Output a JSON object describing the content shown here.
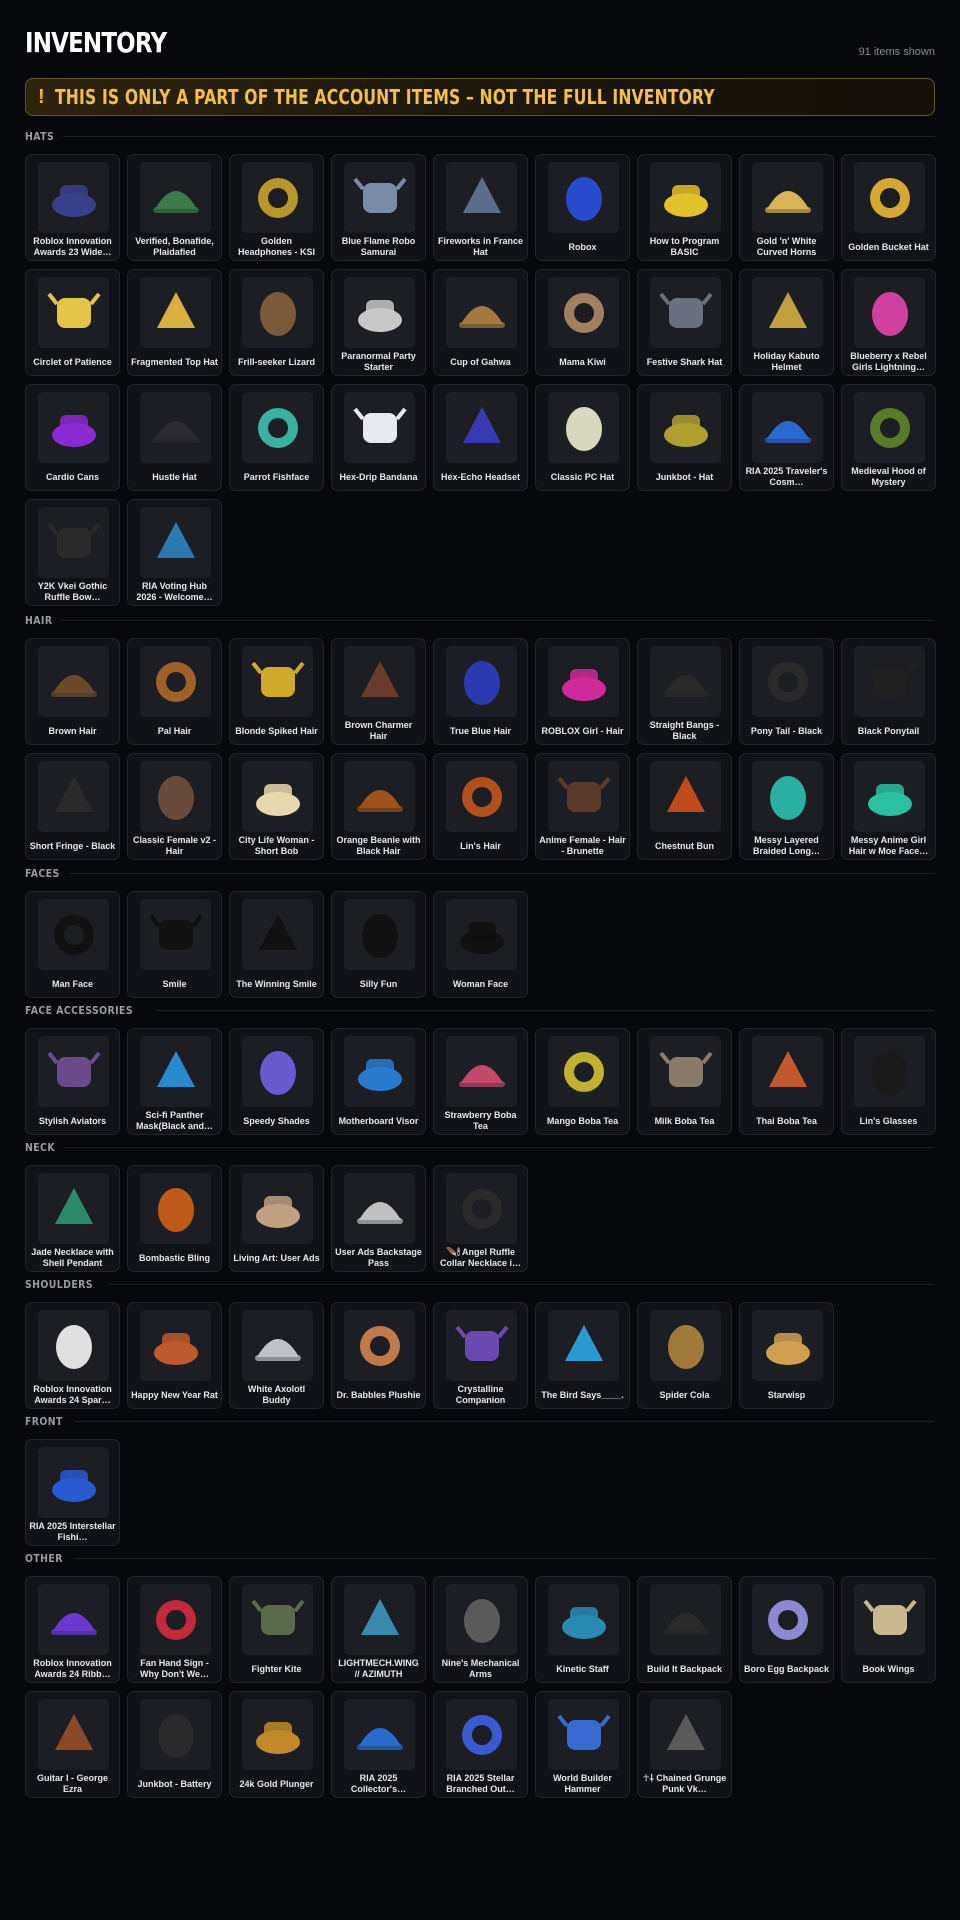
{
  "header": {
    "title": "INVENTORY",
    "count": "91 items shown"
  },
  "warning": {
    "icon": "!",
    "text": "THIS IS ONLY A PART OF THE ACCOUNT ITEMS – NOT THE FULL INVENTORY"
  },
  "colors": {
    "background": "#07080c",
    "card": "#111217",
    "warning_text": "#f3c049",
    "warning_border": "#6a5420"
  },
  "sections": [
    {
      "label": "HATS",
      "items": [
        {
          "name": "Roblox Innovation Awards 23 Wide…",
          "icon": "crown-hat-icon",
          "color": "#3a3f8a"
        },
        {
          "name": "Verified, Bonafide, Plaidafied",
          "icon": "plaid-cap-icon",
          "color": "#3c7a4a"
        },
        {
          "name": "Golden Headphones - KSI",
          "icon": "headphones-icon",
          "color": "#b8962e"
        },
        {
          "name": "Blue Flame Robo Samurai",
          "icon": "samurai-helmet-icon",
          "color": "#7a8aa8"
        },
        {
          "name": "Fireworks in France Hat",
          "icon": "eiffel-tower-icon",
          "color": "#5a6e8a"
        },
        {
          "name": "Robox",
          "icon": "box-icon",
          "color": "#1a2a6a"
        },
        {
          "name": "How to Program BASIC",
          "icon": "book-hat-icon",
          "color": "#e0c22a"
        },
        {
          "name": "Gold 'n' White Curved Horns",
          "icon": "horns-icon",
          "color": "#d8b35a"
        },
        {
          "name": "Golden Bucket Hat",
          "icon": "bucket-hat-icon",
          "color": "#d4a832"
        }
      ]
    },
    {
      "label": "",
      "items": [
        {
          "name": "Circlet of Patience",
          "icon": "circlet-icon",
          "color": "#e2c64a"
        },
        {
          "name": "Fragmented Top Hat",
          "icon": "top-hat-icon",
          "color": "#d8b040"
        },
        {
          "name": "Frill-seeker Lizard",
          "icon": "lizard-icon",
          "color": "#7a5a3a"
        },
        {
          "name": "Paranormal Party Starter",
          "icon": "ghost-icon",
          "color": "#c8c8c8"
        },
        {
          "name": "Cup of Gahwa",
          "icon": "cup-icon",
          "color": "#a07a40"
        },
        {
          "name": "Mama Kiwi",
          "icon": "kiwi-bird-icon",
          "color": "#a08060"
        },
        {
          "name": "Festive Shark Hat",
          "icon": "shark-hat-icon",
          "color": "#6a7080"
        },
        {
          "name": "Holiday Kabuto Helmet",
          "icon": "kabuto-icon",
          "color": "#c0a040"
        },
        {
          "name": "Blueberry x Rebel Girls Lightning…",
          "icon": "lightning-icon",
          "color": "#d040a0"
        }
      ]
    }
  ],
  "all_sections": [
    {
      "label": "HATS",
      "rows": [
        [
          "Roblox Innovation Awards 23 Wide…",
          "Verified, Bonafide, Plaidafied",
          "Golden Headphones - KSI",
          "Blue Flame Robo Samurai",
          "Fireworks in France Hat",
          "Robox",
          "How to Program BASIC",
          "Gold 'n' White Curved Horns",
          "Golden Bucket Hat"
        ],
        [
          "Circlet of Patience",
          "Fragmented Top Hat",
          "Frill-seeker Lizard",
          "Paranormal Party Starter",
          "Cup of Gahwa",
          "Mama Kiwi",
          "Festive Shark Hat",
          "Holiday Kabuto Helmet",
          "Blueberry x Rebel Girls Lightning…"
        ],
        [
          "Cardio Cans",
          "Hustle Hat",
          "Parrot Fishface",
          "Hex-Drip Bandana",
          "Hex-Echo Headset",
          "Classic PC Hat",
          "Junkbot - Hat",
          "RIA 2025 Traveler's Cosm…",
          "Medieval Hood of Mystery"
        ],
        [
          "Y2K Vkei Gothic Ruffle Bow…",
          "RIA Voting Hub 2026 - Welcome…"
        ]
      ],
      "colors": [
        [
          "#3a3f8a",
          "#3c7a4a",
          "#b8962e",
          "#7a8aa8",
          "#5a6e8a",
          "#2a4ad0",
          "#e0c22a",
          "#d8b35a",
          "#d4a832"
        ],
        [
          "#e2c64a",
          "#d8b040",
          "#7a5a3a",
          "#c8c8c8",
          "#a07a40",
          "#a08060",
          "#6a7080",
          "#c0a040",
          "#d040a0"
        ],
        [
          "#8a2ad0",
          "#2a2a30",
          "#3ab0a0",
          "#e8e8f0",
          "#3a3ab0",
          "#d8d8c0",
          "#b0a030",
          "#2a6ad0",
          "#5a7a2a"
        ],
        [
          "#2a2a2a",
          "#2a7ab0"
        ]
      ]
    },
    {
      "label": "HAIR",
      "rows": [
        [
          "Brown Hair",
          "Pal Hair",
          "Blonde Spiked Hair",
          "Brown Charmer Hair",
          "True Blue Hair",
          "ROBLOX Girl - Hair",
          "Straight Bangs - Black",
          "Pony Tail - Black",
          "Black Ponytail"
        ],
        [
          "Short Fringe - Black",
          "Classic Female v2 - Hair",
          "City Life Woman - Short Bob",
          "Orange Beanie with Black Hair",
          "Lin's Hair",
          "Anime Female - Hair - Brunette",
          "Chestnut Bun",
          "Messy Layered Braided Long…",
          "Messy Anime Girl Hair w Moe Face…"
        ]
      ],
      "colors": [
        [
          "#6a4a2a",
          "#a0602a",
          "#d0a82a",
          "#6a3a2a",
          "#2a3ab0",
          "#d02a9a",
          "#2a2a2a",
          "#2a2a2a",
          "#202020"
        ],
        [
          "#2a2a2a",
          "#6a4a3a",
          "#e8d8b0",
          "#a0501a",
          "#b0501a",
          "#5a3a2a",
          "#c04a1a",
          "#2ab0a0",
          "#2ac0a0"
        ]
      ]
    },
    {
      "label": "FACES",
      "rows": [
        [
          "Man Face",
          "Smile",
          "The Winning Smile",
          "Silly Fun",
          "Woman Face"
        ]
      ],
      "colors": [
        [
          "#111111",
          "#111111",
          "#111111",
          "#111111",
          "#111111"
        ]
      ]
    },
    {
      "label": "FACE ACCESSORIES",
      "rows": [
        [
          "Stylish Aviators",
          "Sci-fi Panther Mask(Black and…",
          "Speedy Shades",
          "Motherboard Visor",
          "Strawberry Boba Tea",
          "Mango Boba Tea",
          "Milk Boba Tea",
          "Thai Boba Tea",
          "Lin's Glasses"
        ]
      ],
      "colors": [
        [
          "#6a4a8a",
          "#2a8ad0",
          "#6a5ad0",
          "#2a7ad0",
          "#c04a6a",
          "#c0b030",
          "#8a7a6a",
          "#c05a2a",
          "#1a1a1a"
        ]
      ]
    },
    {
      "label": "NECK",
      "rows": [
        [
          "Jade Necklace with Shell Pendant",
          "Bombastic Bling",
          "Living Art: User Ads",
          "User Ads Backstage Pass",
          "🪶🕯 Angel Ruffle Collar Necklace i…"
        ]
      ],
      "colors": [
        [
          "#2a8a6a",
          "#c05a1a",
          "#c0a080",
          "#c0c0c0",
          "#2a2a2a"
        ]
      ]
    },
    {
      "label": "SHOULDERS",
      "rows": [
        [
          "Roblox Innovation Awards 24 Spar…",
          "Happy New Year Rat",
          "White Axolotl Buddy",
          "Dr. Babbles Plushie",
          "Crystalline Companion",
          "The Bird Says____.",
          "Spider Cola",
          "Starwisp"
        ]
      ],
      "colors": [
        [
          "#e0e0e0",
          "#c05a2a",
          "#c0c0c8",
          "#c07a4a",
          "#6a4ab0",
          "#2a9ad0",
          "#a07a3a",
          "#d0a050"
        ]
      ]
    },
    {
      "label": "FRONT",
      "rows": [
        [
          "RIA 2025 Interstellar Fishi…"
        ]
      ],
      "colors": [
        [
          "#2a5ad0"
        ]
      ]
    },
    {
      "label": "OTHER",
      "rows": [
        [
          "Roblox Innovation Awards 24 Ribb…",
          "Fan Hand Sign - Why Don't We…",
          "Fighter Kite",
          "LIGHTMECH.WING // AZIMUTH",
          "Nine's Mechanical Arms",
          "Kinetic Staff",
          "Build It Backpack",
          "Boro Egg Backpack",
          "Book Wings"
        ],
        [
          "Guitar I - George Ezra",
          "Junkbot - Battery",
          "24k Gold Plunger",
          "RIA 2025 Collector's…",
          "RIA 2025 Stellar Branched Out…",
          "World Builder Hammer",
          "☥⸸ Chained Grunge Punk Vk…"
        ]
      ],
      "colors": [
        [
          "#6a3ad0",
          "#c02a3a",
          "#5a6a4a",
          "#3a8ab0",
          "#5a5a5a",
          "#2a8ab0",
          "#2a2a2a",
          "#8a8ad0",
          "#c8b890"
        ],
        [
          "#8a4a2a",
          "#2a2a2a",
          "#c08a2a",
          "#2a6ad0",
          "#3a5ad0",
          "#3a6ad0",
          "#5a5a5a"
        ]
      ]
    }
  ]
}
